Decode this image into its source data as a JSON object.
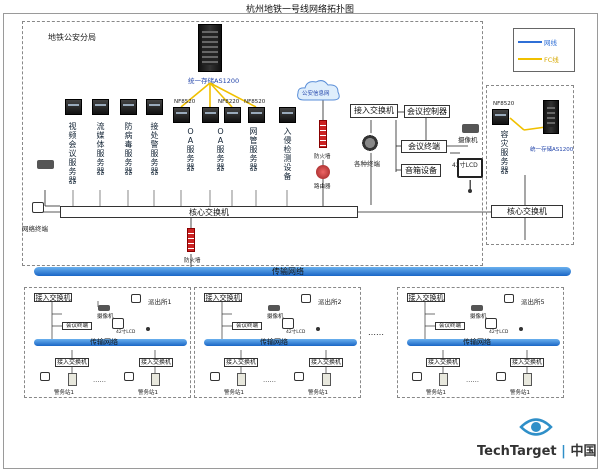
{
  "title": "杭州地铁一号线网络拓扑图",
  "bureau_label": "地铁公安分局",
  "storage_top_label": "统一存储AS1200",
  "storage_right_label": "统一存储AS1200",
  "legend": {
    "line1": "网线",
    "line2": "FC线",
    "color1": "#2f6fd6",
    "color2": "#f0c000"
  },
  "servers": [
    "视频会议服务器",
    "流媒体服务器",
    "防病毒服务器",
    "接处警服务器",
    "OA服务器",
    "OA服务器",
    "网管服务器",
    "入侵检测设备"
  ],
  "nf_labels": [
    "NF8520",
    "NF8220",
    "NF8520",
    "NF8520"
  ],
  "cloud_label": "公安信息网",
  "firewall_top": "防火墙",
  "router_label": "路由器",
  "firewall_bottom": "防火墙",
  "camera_left_label": "网络终端",
  "core_switch": "核心交换机",
  "core_switch_right": "核心交换机",
  "access_switch": "接入交换机",
  "various_terminals": "各种终端",
  "conf_controller": "会议控制器",
  "conf_terminal": "会议终端",
  "audio_device": "音箱设备",
  "camera_label": "摄像机",
  "lcd_label": "42寸LCD",
  "dr_server": "容灾服务器",
  "transport_main": "传输网络",
  "stations": [
    {
      "name": "派出所1",
      "access1": "接入交换机",
      "conf": "会议终端",
      "camera": "摄像机",
      "transport": "传输网络",
      "sw_a": "接入交换机",
      "sw_b": "接入交换机",
      "ws_a": "警务站1",
      "ws_b": "警务站1",
      "lcd": "42寸LCD"
    },
    {
      "name": "派出所2",
      "access1": "接入交换机",
      "conf": "会议终端",
      "camera": "摄像机",
      "transport": "传输网络",
      "sw_a": "接入交换机",
      "sw_b": "接入交换机",
      "ws_a": "警务站1",
      "ws_b": "警务站1",
      "lcd": "42寸LCD"
    },
    {
      "name": "派出所5",
      "access1": "接入交换机",
      "conf": "会议终端",
      "camera": "摄像机",
      "transport": "传输网络",
      "sw_a": "接入交换机",
      "sw_b": "接入交换机",
      "ws_a": "警务站1",
      "ws_b": "警务站1",
      "lcd": "42寸LCD"
    }
  ],
  "ellipsis": "……",
  "ellipsis2": "……",
  "brand": "TechTarget",
  "brand_cn": "中国"
}
